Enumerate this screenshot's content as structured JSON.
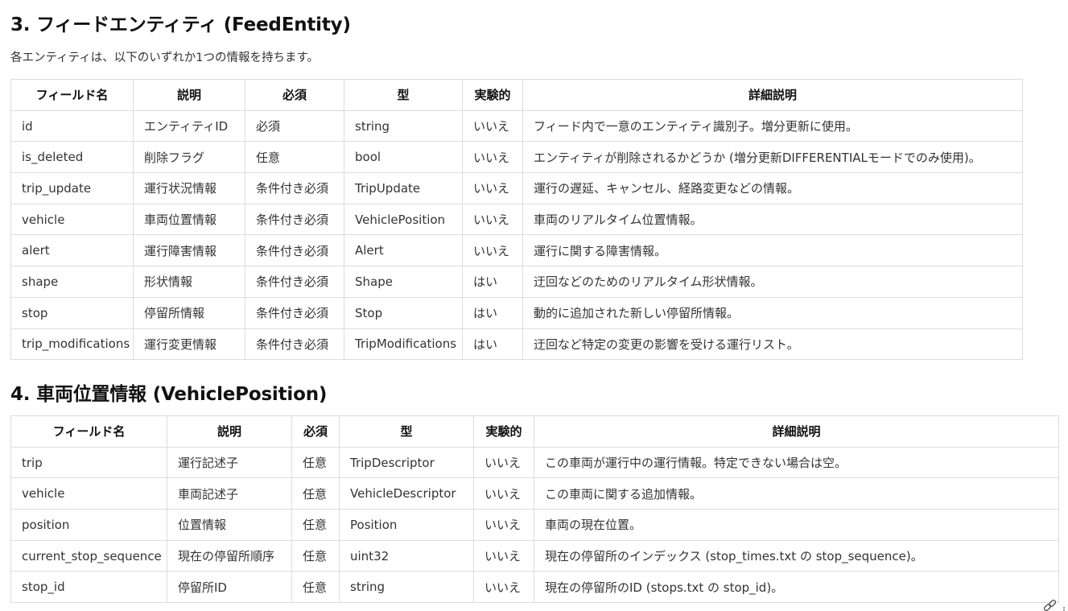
{
  "section3": {
    "title": "3. フィードエンティティ (FeedEntity)",
    "intro": "各エンティティは、以下のいずれか1つの情報を持ちます。",
    "headers": [
      "フィールド名",
      "説明",
      "必須",
      "型",
      "実験的",
      "詳細説明"
    ],
    "rows": [
      [
        "id",
        "エンティティID",
        "必須",
        "string",
        "いいえ",
        "フィード内で一意のエンティティ識別子。増分更新に使用。"
      ],
      [
        "is_deleted",
        "削除フラグ",
        "任意",
        "bool",
        "いいえ",
        "エンティティが削除されるかどうか (増分更新DIFFERENTIALモードでのみ使用)。"
      ],
      [
        "trip_update",
        "運行状況情報",
        "条件付き必須",
        "TripUpdate",
        "いいえ",
        "運行の遅延、キャンセル、経路変更などの情報。"
      ],
      [
        "vehicle",
        "車両位置情報",
        "条件付き必須",
        "VehiclePosition",
        "いいえ",
        "車両のリアルタイム位置情報。"
      ],
      [
        "alert",
        "運行障害情報",
        "条件付き必須",
        "Alert",
        "いいえ",
        "運行に関する障害情報。"
      ],
      [
        "shape",
        "形状情報",
        "条件付き必須",
        "Shape",
        "はい",
        "迂回などのためのリアルタイム形状情報。"
      ],
      [
        "stop",
        "停留所情報",
        "条件付き必須",
        "Stop",
        "はい",
        "動的に追加された新しい停留所情報。"
      ],
      [
        "trip_modifications",
        "運行変更情報",
        "条件付き必須",
        "TripModifications",
        "はい",
        "迂回など特定の変更の影響を受ける運行リスト。"
      ]
    ]
  },
  "section4": {
    "title": "4. 車両位置情報 (VehiclePosition)",
    "headers": [
      "フィールド名",
      "説明",
      "必須",
      "型",
      "実験的",
      "詳細説明"
    ],
    "rows": [
      [
        "trip",
        "運行記述子",
        "任意",
        "TripDescriptor",
        "いいえ",
        "この車両が運行中の運行情報。特定できない場合は空。"
      ],
      [
        "vehicle",
        "車両記述子",
        "任意",
        "VehicleDescriptor",
        "いいえ",
        "この車両に関する追加情報。"
      ],
      [
        "position",
        "位置情報",
        "任意",
        "Position",
        "いいえ",
        "車両の現在位置。"
      ],
      [
        "current_stop_sequence",
        "現在の停留所順序",
        "任意",
        "uint32",
        "いいえ",
        "現在の停留所のインデックス (stop_times.txt の stop_sequence)。"
      ],
      [
        "stop_id",
        "停留所ID",
        "任意",
        "string",
        "いいえ",
        "現在の停留所のID (stops.txt の stop_id)。"
      ]
    ]
  },
  "icons": {
    "corner": "link-icon"
  }
}
